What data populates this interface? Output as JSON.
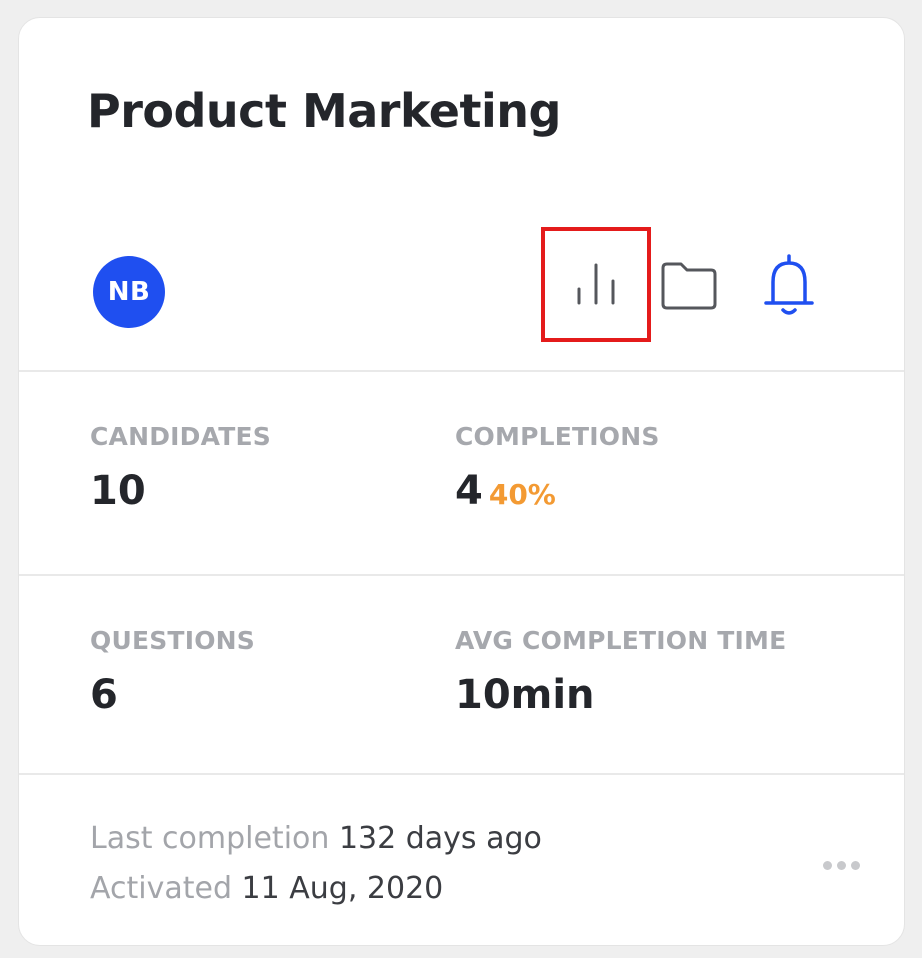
{
  "card": {
    "title": "Product Marketing",
    "owner_initials": "NB",
    "colors": {
      "avatar": "#1f4ff0",
      "bell": "#1f4ff0",
      "highlight": "#e41b1b",
      "percent": "#f39a33"
    },
    "icons": [
      "bar-chart-icon",
      "folder-icon",
      "bell-icon",
      "more-dots-icon"
    ]
  },
  "stats": {
    "candidates_label": "CANDIDATES",
    "candidates_value": "10",
    "completions_label": "COMPLETIONS",
    "completions_value": "4",
    "completions_percent": "40%",
    "questions_label": "QUESTIONS",
    "questions_value": "6",
    "avg_time_label": "AVG COMPLETION TIME",
    "avg_time_value": "10min"
  },
  "footer": {
    "last_completion_label": "Last completion",
    "last_completion_value": "132 days ago",
    "activated_label": "Activated",
    "activated_value": "11 Aug, 2020"
  }
}
